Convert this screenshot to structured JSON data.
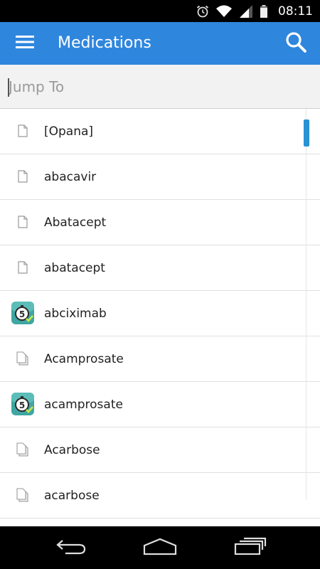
{
  "status_bar": {
    "time": "08:11",
    "icons": [
      "alarm-icon",
      "wifi-icon",
      "signal-icon",
      "battery-icon"
    ]
  },
  "app_bar": {
    "title": "Medications",
    "menu_icon": "hamburger-menu-icon",
    "search_icon": "search-icon",
    "color": "#2f86dd"
  },
  "jump_to": {
    "placeholder": "Jump To",
    "value": ""
  },
  "list": {
    "items": [
      {
        "label": "[Opana]",
        "icon": "document-icon"
      },
      {
        "label": "abacavir",
        "icon": "document-icon"
      },
      {
        "label": "Abatacept",
        "icon": "document-icon"
      },
      {
        "label": "abatacept",
        "icon": "document-icon"
      },
      {
        "label": "abciximab",
        "icon": "calculator-badge-icon"
      },
      {
        "label": "Acamprosate",
        "icon": "multi-document-icon"
      },
      {
        "label": "acamprosate",
        "icon": "calculator-badge-icon"
      },
      {
        "label": "Acarbose",
        "icon": "multi-document-icon"
      },
      {
        "label": "acarbose",
        "icon": "multi-document-icon"
      }
    ],
    "accent": "#2a92d4"
  },
  "nav_bar": {
    "icons": [
      "back-icon",
      "home-icon",
      "recent-apps-icon"
    ]
  }
}
